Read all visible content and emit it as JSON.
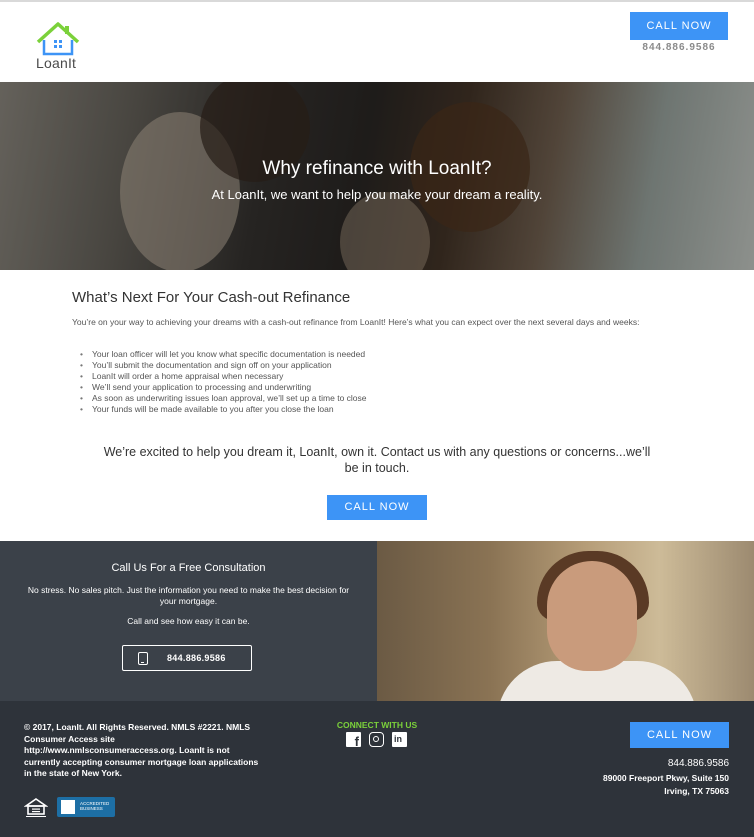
{
  "header": {
    "logo_text": "LoanIt",
    "cta_label": "CALL NOW",
    "phone": "844.886.9586"
  },
  "hero": {
    "title": "Why refinance with LoanIt?",
    "subtitle": "At LoanIt, we want to help you make your dream a reality."
  },
  "main": {
    "title": "What’s Next For Your Cash-out Refinance",
    "intro": "You’re on your way to achieving your dreams with a cash-out refinance from LoanIt! Here’s what you can expect over the next several days and weeks:",
    "steps": [
      "Your loan officer will let you know what specific documentation is needed",
      "You’ll submit the documentation and sign off on your application",
      "LoanIt will order a home appraisal when necessary",
      "We’ll send your application to processing and underwriting",
      "As soon as underwriting issues loan approval, we’ll set up a time to close",
      "Your funds will be made available to you after you close the loan"
    ],
    "closing": "We’re excited to help you dream it, LoanIt, own it. Contact us with any questions or concerns...we’ll be in touch.",
    "cta_label": "CALL NOW"
  },
  "consult": {
    "title": "Call Us For a Free Consultation",
    "text": "No stress. No sales pitch. Just the information you need to make the best decision for your mortgage.",
    "text2": "Call and see how easy it can be.",
    "phone": "844.886.9586"
  },
  "footer": {
    "legal": "© 2017, LoanIt. All Rights Reserved. NMLS #2221. NMLS Consumer Access site http://www.nmlsconsumeraccess.org. LoanIt is not currently accepting consumer mortgage loan applications in the state of New York.",
    "bbb_label": "ACCREDITED BUSINESS",
    "connect_label": "CONNECT WITH US",
    "social_icons": [
      "facebook-icon",
      "instagram-icon",
      "linkedin-icon"
    ],
    "cta_label": "CALL NOW",
    "phone": "844.886.9586",
    "address_line1": "89000 Freeport Pkwy, Suite 150",
    "address_line2": "Irving, TX 75063"
  },
  "colors": {
    "accent_blue": "#3d94f6",
    "logo_green": "#7bd13a",
    "dark_section": "#3b4149",
    "footer_bg": "#2e333a"
  }
}
